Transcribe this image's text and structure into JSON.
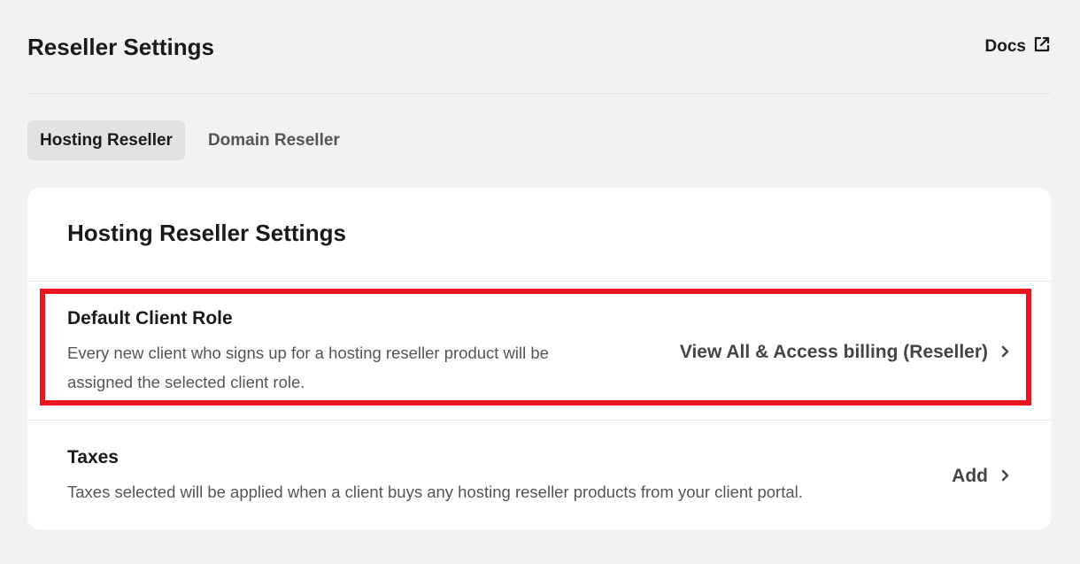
{
  "header": {
    "title": "Reseller Settings",
    "docs_label": "Docs"
  },
  "tabs": [
    {
      "label": "Hosting Reseller",
      "active": true
    },
    {
      "label": "Domain Reseller",
      "active": false
    }
  ],
  "card": {
    "title": "Hosting Reseller Settings",
    "settings": [
      {
        "title": "Default Client Role",
        "description": "Every new client who signs up for a hosting reseller product will be assigned the selected client role.",
        "action_label": "View All & Access billing (Reseller)"
      },
      {
        "title": "Taxes",
        "description": "Taxes selected will be applied when a client buys any hosting reseller products from your client portal.",
        "action_label": "Add"
      }
    ]
  },
  "colors": {
    "highlight": "#e8141e",
    "background": "#f2f2f2",
    "active_tab": "#e2e2e2"
  },
  "icons": {
    "docs": "external-link-icon",
    "action": "chevron-right-icon"
  }
}
